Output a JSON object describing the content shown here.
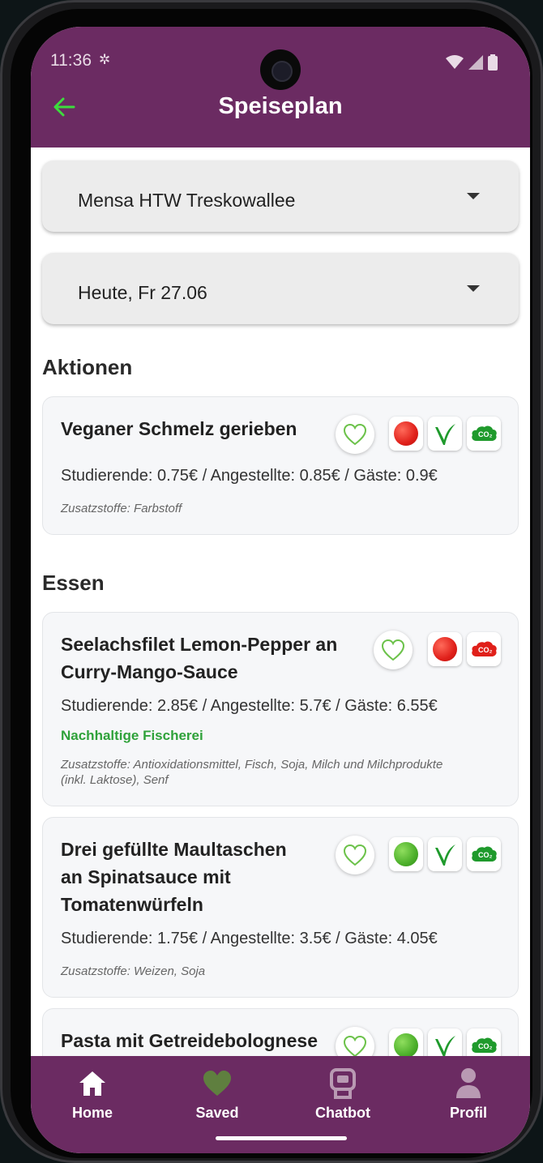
{
  "status": {
    "time": "11:36"
  },
  "header": {
    "title": "Speiseplan"
  },
  "selectors": {
    "canteen": "Mensa HTW Treskowallee",
    "date": "Heute, Fr 27.06"
  },
  "sections": {
    "actions_title": "Aktionen",
    "meals_title": "Essen"
  },
  "actions": [
    {
      "title_line1": "Veganer Schmelz gerieben",
      "price": "Studierende: 0.75€ / Angestellte: 0.85€ / Gäste: 0.9€",
      "additives": "Zusatzstoffe: Farbstoff",
      "traffic_light": "red",
      "vegan": true,
      "co2": "green"
    }
  ],
  "meals": [
    {
      "title_line1": "Seelachsfilet Lemon-Pepper an",
      "title_line2": "Curry-Mango-Sauce",
      "price": "Studierende: 2.85€ / Angestellte: 5.7€ / Gäste: 6.55€",
      "sustainability": "Nachhaltige Fischerei",
      "additives_line1": "Zusatzstoffe: Antioxidationsmittel, Fisch, Soja, Milch und Milchprodukte",
      "additives_line2": "(inkl. Laktose), Senf",
      "traffic_light": "red",
      "vegan": false,
      "co2": "red"
    },
    {
      "title_line1": "Drei gefüllte Maultaschen",
      "title_line2": "an Spinatsauce mit",
      "title_line3": "Tomatenwürfeln",
      "price": "Studierende: 1.75€ / Angestellte: 3.5€ / Gäste: 4.05€",
      "additives": "Zusatzstoffe: Weizen, Soja",
      "traffic_light": "green",
      "vegan": true,
      "co2": "green"
    },
    {
      "title_line1": "Pasta mit Getreidebolognese",
      "traffic_light": "green",
      "vegan": true,
      "co2": "green"
    }
  ],
  "co2_label": "CO₂",
  "nav": {
    "home": "Home",
    "saved": "Saved",
    "chatbot": "Chatbot",
    "profile": "Profil"
  },
  "colors": {
    "primary": "#6b2b62",
    "accent_green": "#2fa23a",
    "back_arrow": "#3ddc3d"
  }
}
